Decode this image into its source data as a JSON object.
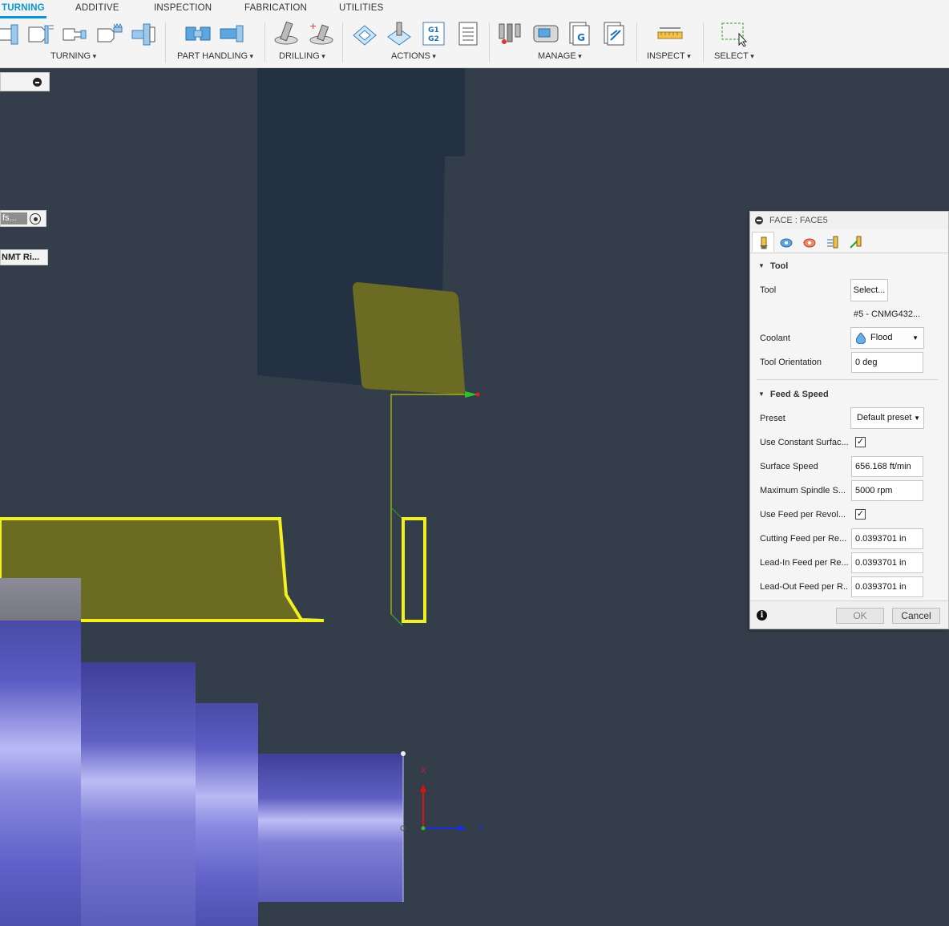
{
  "tabs": [
    "TURNING",
    "ADDITIVE",
    "INSPECTION",
    "FABRICATION",
    "UTILITIES"
  ],
  "groups": {
    "turning": "TURNING",
    "part_handling": "PART HANDLING",
    "drilling": "DRILLING",
    "actions": "ACTIONS",
    "manage": "MANAGE",
    "inspect": "INSPECT",
    "select": "SELECT"
  },
  "toolbar_icons": {
    "actions_g1g2": "G1\nG2",
    "manage_g": "G"
  },
  "left_panel": {
    "widget2": "fs...",
    "widget3": "NMT Ri..."
  },
  "viewport": {
    "axis_x": "X",
    "axis_z": "Z",
    "colors": {
      "background": "#343e4a",
      "toolholder": "#243142",
      "insert": "#6b6b24",
      "yellow_outline": "#f3f020",
      "stock": "#6b6bd0",
      "toolpath": "#c8d000"
    }
  },
  "dialog": {
    "title": "FACE : FACE5",
    "tabs": [
      "tool-tab",
      "geometry-tab",
      "heights-tab",
      "passes-tab",
      "linking-tab"
    ],
    "section_tool": "Tool",
    "tool_label": "Tool",
    "tool_select": "Select...",
    "tool_name": "#5 - CNMG432...",
    "coolant_label": "Coolant",
    "coolant_value": "Flood",
    "tool_orientation_label": "Tool Orientation",
    "tool_orientation_value": "0 deg",
    "section_feed": "Feed & Speed",
    "preset_label": "Preset",
    "preset_value": "Default preset",
    "css_label": "Use Constant Surfac...",
    "css_checked": true,
    "surface_speed_label": "Surface Speed",
    "surface_speed_value": "656.168 ft/min",
    "max_spindle_label": "Maximum Spindle S...",
    "max_spindle_value": "5000 rpm",
    "feed_per_rev_label": "Use Feed per Revol...",
    "feed_per_rev_checked": true,
    "cutting_feed_label": "Cutting Feed per Re...",
    "cutting_feed_value": "0.0393701 in",
    "lead_in_label": "Lead-In Feed per Re...",
    "lead_in_value": "0.0393701 in",
    "lead_out_label": "Lead-Out Feed per R...",
    "lead_out_value": "0.0393701 in",
    "ok": "OK",
    "cancel": "Cancel"
  }
}
